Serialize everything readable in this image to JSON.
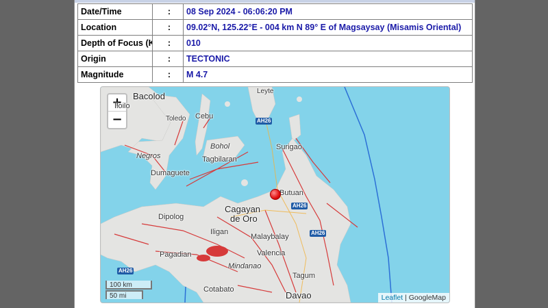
{
  "quake": {
    "rows": [
      {
        "label": "Date/Time",
        "value": "08 Sep 2024 - 06:06:20 PM"
      },
      {
        "label": "Location",
        "value": "09.02°N, 125.22°E - 004 km N 89° E of Magsaysay (Misamis Oriental)"
      },
      {
        "label": "Depth of Focus (Km)",
        "value": "010"
      },
      {
        "label": "Origin",
        "value": "TECTONIC"
      },
      {
        "label": "Magnitude",
        "value": "M 4.7"
      }
    ],
    "separator": ":"
  },
  "map": {
    "zoom_in": "+",
    "zoom_out": "−",
    "scale_km": "100 km",
    "scale_mi": "50 mi",
    "attribution_link": "Leaflet",
    "attribution_sep": " | ",
    "attribution_text": "GoogleMap",
    "highways": [
      "AH26",
      "AH26",
      "AH26",
      "AH26"
    ],
    "places": {
      "bacolod": "Bacolod",
      "iloilo": "Iloilo",
      "leyte": "Leyte",
      "toledo": "Toledo",
      "cebu": "Cebu",
      "surigao": "Surigao",
      "negros": "Negros",
      "bohol": "Bohol",
      "tagbilaran": "Tagbilaran",
      "dumaguete": "Dumaguete",
      "butuan": "Butuan",
      "cagayan1": "Cagayan",
      "cagayan2": "de Oro",
      "dipolog": "Dipolog",
      "iligan": "Iligan",
      "malaybalay": "Malaybalay",
      "pagadian": "Pagadian",
      "valencia": "Valencia",
      "mindanao": "Mindanao",
      "tagum": "Tagum",
      "cotabato": "Cotabato",
      "davao": "Davao"
    },
    "colors": {
      "sea": "#83d3ea",
      "land": "#e4e4e2",
      "fault": "#d63a3a",
      "trench": "#2c6fd6",
      "marker": "#e01010"
    }
  }
}
